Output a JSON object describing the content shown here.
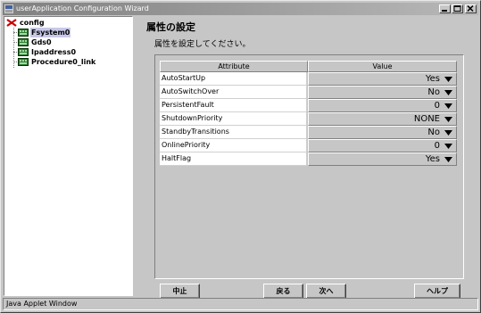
{
  "window": {
    "title": "userApplication Configuration Wizard"
  },
  "tree": {
    "root": "config",
    "children": [
      "Fsystem0",
      "Gds0",
      "Ipaddress0",
      "Procedure0_link"
    ],
    "selected": "Fsystem0"
  },
  "content": {
    "heading": "属性の設定",
    "subheading": "属性を設定してください。",
    "table": {
      "headers": [
        "Attribute",
        "Value"
      ],
      "rows": [
        {
          "attribute": "AutoStartUp",
          "value": "Yes"
        },
        {
          "attribute": "AutoSwitchOver",
          "value": "No"
        },
        {
          "attribute": "PersistentFault",
          "value": "0"
        },
        {
          "attribute": "ShutdownPriority",
          "value": "NONE"
        },
        {
          "attribute": "StandbyTransitions",
          "value": "No"
        },
        {
          "attribute": "OnlinePriority",
          "value": "0"
        },
        {
          "attribute": "HaltFlag",
          "value": "Yes"
        }
      ]
    }
  },
  "buttons": {
    "cancel": "中止",
    "back": "戻る",
    "next": "次へ",
    "help": "ヘルプ"
  },
  "statusbar": {
    "text": "Java Applet Window"
  },
  "colors": {
    "window_bg": "#c6c6c6",
    "titlebar_start": "#808080",
    "titlebar_end": "#b8b8b8",
    "selection": "#c8c8e8",
    "root_icon": "#cc0000",
    "node_icon": "#006400"
  }
}
